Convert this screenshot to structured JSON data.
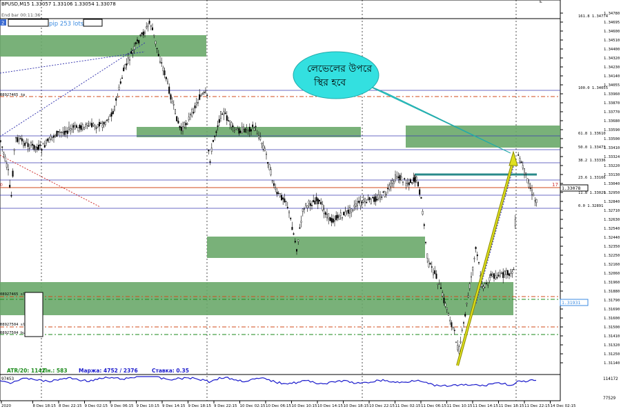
{
  "header": {
    "symbol_info": "BPUSD,M15  1.33057 1.33106 1.33054 1.33078",
    "end_bar": "End bar 00:11:36",
    "badge": "2",
    "pip_text": "pip 253 lots"
  },
  "price_axis": {
    "ticks": [
      "1.34780",
      "1.34695",
      "1.34600",
      "1.34510",
      "1.34400",
      "1.34320",
      "1.34230",
      "1.34140",
      "1.34055",
      "1.33960",
      "1.33870",
      "1.33770",
      "1.33680",
      "1.33590",
      "1.33500",
      "1.33410",
      "1.33324",
      "1.33220",
      "1.33130",
      "1.33040",
      "1.32950",
      "1.32840",
      "1.32710",
      "1.32630",
      "1.32540",
      "1.32440",
      "1.32350",
      "1.32250",
      "1.32160",
      "1.32060",
      "1.31960",
      "1.31880",
      "1.31790",
      "1.31690",
      "1.31600",
      "1.31500",
      "1.31410",
      "1.31320",
      "1.31250",
      "1.31140"
    ],
    "current_price": "1.33078",
    "blue_marker": "1.31931"
  },
  "fib_levels": [
    {
      "label": "161.8  1.34774"
    },
    {
      "label": "100.0  1.34055"
    },
    {
      "label": "61.8  1.33610"
    },
    {
      "label": "50.0  1.33473"
    },
    {
      "label": "38.2  1.33336"
    },
    {
      "label": "23.6  1.33166"
    },
    {
      "label": "11.8  1.33029"
    },
    {
      "label": "0.0  1.32891"
    }
  ],
  "left_labels": {
    "ticket_top": "08927465 tp",
    "ticket_buy1": "08927465 sl",
    "ticket_buy2": "08927504 buy",
    "ticket_sl2": "08927504 sl",
    "ticket_buy3": "08927504 buy",
    "marker_0": "0",
    "right_17": "17"
  },
  "callout": {
    "line1": "লেভেলের উপরে",
    "line2": "স্থির হবে"
  },
  "status": {
    "atr": "ATR/20: 1142",
    "pn": "Пн.: 583",
    "margin": "Маржа: 4752 / 2376",
    "stake": "Ставка: 0.35"
  },
  "indicator": {
    "left_value": "97453",
    "right_top": "114172",
    "right_bottom": "77529"
  },
  "time_axis": [
    "2020",
    "8 Dec 18:15",
    "8 Dec 22:15",
    "9 Dec 02:15",
    "9 Dec 06:15",
    "9 Dec 10:15",
    "9 Dec 14:15",
    "9 Dec 18:15",
    "9 Dec 22:15",
    "10 Dec 02:15",
    "10 Dec 06:15",
    "10 Dec 10:15",
    "10 Dec 14:15",
    "10 Dec 18:15",
    "10 Dec 22:15",
    "11 Dec 02:15",
    "11 Dec 06:15",
    "11 Dec 10:15",
    "11 Dec 14:15",
    "11 Dec 18:15",
    "11 Dec 22:15",
    "14 Dec 02:15"
  ],
  "colors": {
    "zone": "#6aa86a",
    "fib": "#3a3ab0",
    "candle": "#000000",
    "callout": "#33e0e0",
    "arrow": "#c8c800",
    "indicator": "#1a1acc",
    "status_green": "#1a8a1a",
    "status_blue": "#1a1acc"
  }
}
